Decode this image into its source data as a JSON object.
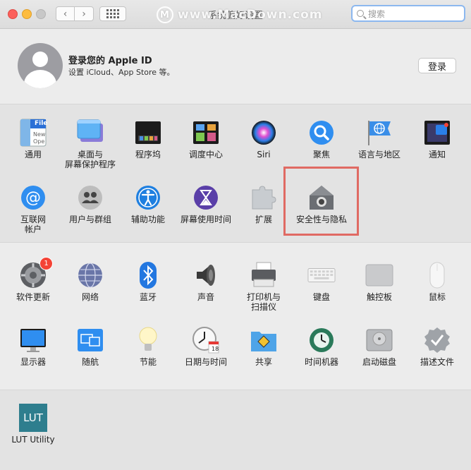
{
  "window": {
    "title": "系统偏好设置",
    "watermark": "www.MacDown.com",
    "watermark_logo": "M",
    "back_glyph": "‹",
    "forward_glyph": "›"
  },
  "search": {
    "placeholder": "搜索"
  },
  "account": {
    "title": "登录您的 Apple ID",
    "subtitle": "设置 iCloud、App Store 等。",
    "login_label": "登录"
  },
  "rows": {
    "row1": [
      {
        "label": "通用",
        "icon": "general-icon"
      },
      {
        "label": "桌面与\n屏幕保护程序",
        "icon": "desktop-screensaver-icon"
      },
      {
        "label": "程序坞",
        "icon": "dock-icon"
      },
      {
        "label": "调度中心",
        "icon": "mission-control-icon"
      },
      {
        "label": "Siri",
        "icon": "siri-icon"
      },
      {
        "label": "聚焦",
        "icon": "spotlight-icon"
      },
      {
        "label": "语言与地区",
        "icon": "language-region-icon"
      },
      {
        "label": "通知",
        "icon": "notifications-icon"
      }
    ],
    "row2": [
      {
        "label": "互联网\n帐户",
        "icon": "internet-accounts-icon"
      },
      {
        "label": "用户与群组",
        "icon": "users-groups-icon"
      },
      {
        "label": "辅助功能",
        "icon": "accessibility-icon"
      },
      {
        "label": "屏幕使用时间",
        "icon": "screen-time-icon"
      },
      {
        "label": "扩展",
        "icon": "extensions-icon"
      },
      {
        "label": "安全性与隐私",
        "icon": "security-privacy-icon"
      }
    ],
    "row3": [
      {
        "label": "软件更新",
        "icon": "software-update-icon",
        "badge": "1"
      },
      {
        "label": "网络",
        "icon": "network-icon"
      },
      {
        "label": "蓝牙",
        "icon": "bluetooth-icon"
      },
      {
        "label": "声音",
        "icon": "sound-icon"
      },
      {
        "label": "打印机与\n扫描仪",
        "icon": "printers-scanners-icon"
      },
      {
        "label": "键盘",
        "icon": "keyboard-icon"
      },
      {
        "label": "触控板",
        "icon": "trackpad-icon"
      },
      {
        "label": "鼠标",
        "icon": "mouse-icon"
      }
    ],
    "row4": [
      {
        "label": "显示器",
        "icon": "displays-icon"
      },
      {
        "label": "随航",
        "icon": "sidecar-icon"
      },
      {
        "label": "节能",
        "icon": "energy-saver-icon"
      },
      {
        "label": "日期与时间",
        "icon": "date-time-icon",
        "day": "18"
      },
      {
        "label": "共享",
        "icon": "sharing-icon"
      },
      {
        "label": "时间机器",
        "icon": "time-machine-icon"
      },
      {
        "label": "启动磁盘",
        "icon": "startup-disk-icon"
      },
      {
        "label": "描述文件",
        "icon": "profiles-icon"
      }
    ],
    "row5": [
      {
        "label": "LUT Utility",
        "icon": "lut-utility-icon",
        "text": "LUT"
      }
    ]
  },
  "general_icon_text": [
    "File",
    "New",
    "Ope"
  ],
  "colors": {
    "highlight": "#e06a63",
    "badge": "#f44336",
    "search_focus": "#8cb8ef"
  }
}
